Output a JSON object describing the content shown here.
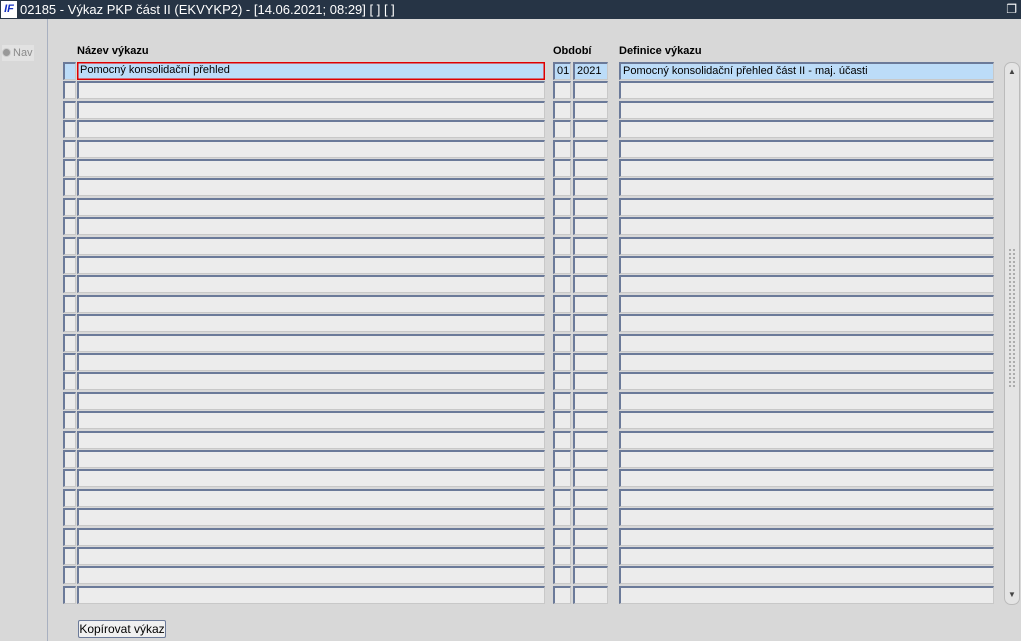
{
  "window": {
    "title": "02185 - Výkaz PKP část II (EKVYKP2) - [14.06.2021; 08:29]  [ ]  [ ]",
    "logo": "IF",
    "restore_icon": "restore-icon"
  },
  "nav": {
    "label": "Nav"
  },
  "headers": {
    "name": "Název výkazu",
    "period": "Období",
    "definition": "Definice výkazu"
  },
  "rows": [
    {
      "name": "Pomocný konsolidační přehled",
      "month": "01",
      "year": "2021",
      "definition": "Pomocný konsolidační přehled část II - maj. účasti"
    }
  ],
  "row_count": 28,
  "buttons": {
    "copy": "Kopírovat výkaz"
  }
}
